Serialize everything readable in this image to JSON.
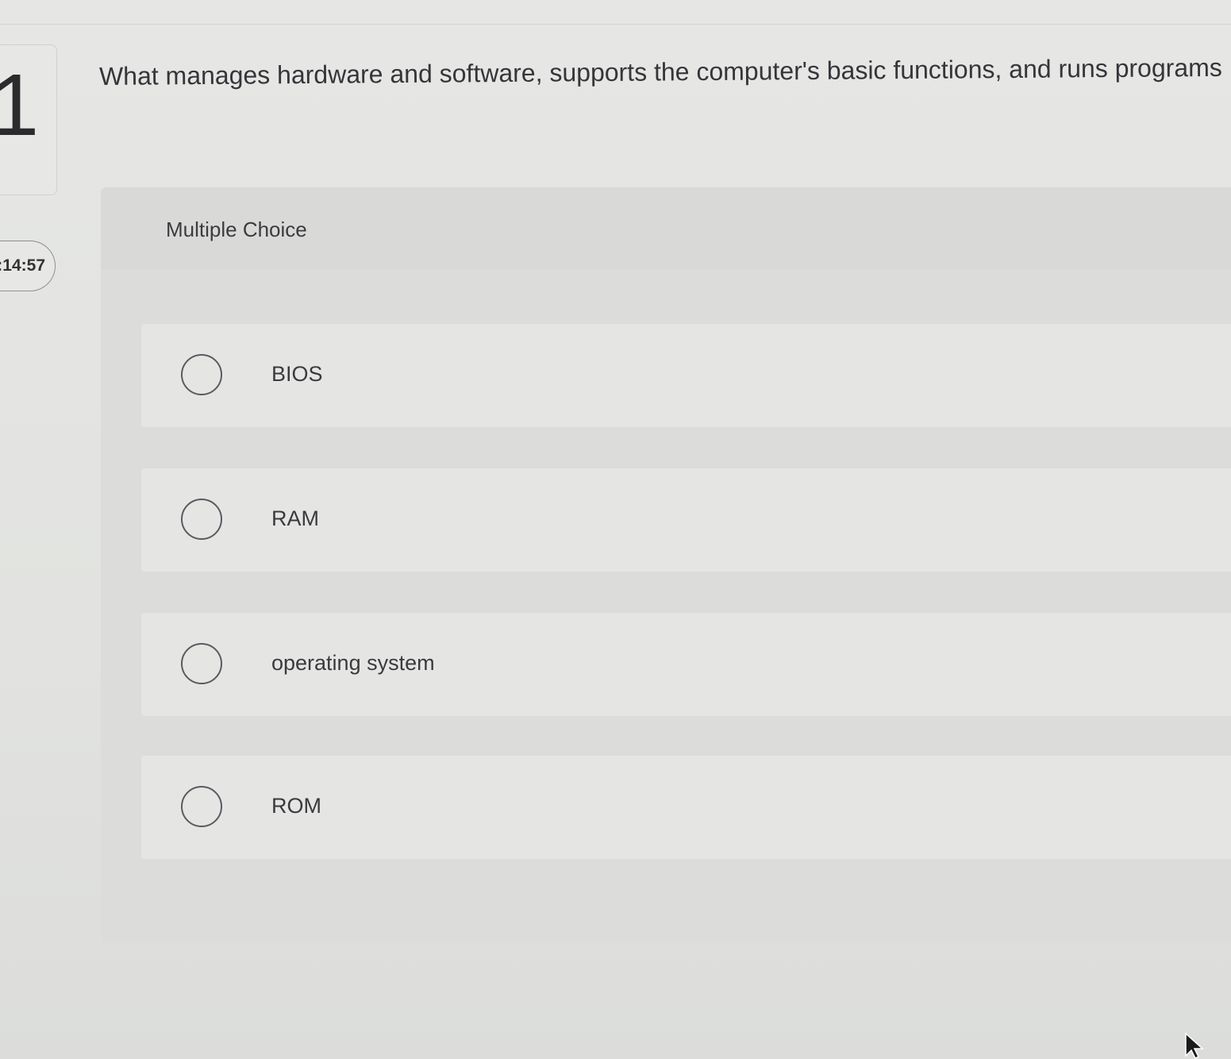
{
  "question": {
    "number": "1",
    "text": "What manages hardware and software, supports the computer's basic functions, and runs programs"
  },
  "timer": {
    "display": ":14:57"
  },
  "answer_area": {
    "type_label": "Multiple Choice",
    "options": [
      {
        "label": "BIOS",
        "selected": false
      },
      {
        "label": "RAM",
        "selected": false
      },
      {
        "label": "operating system",
        "selected": false
      },
      {
        "label": "ROM",
        "selected": false
      }
    ]
  },
  "colors": {
    "background": "#e3e4e2",
    "panel": "#dcdddb",
    "option_row": "#e5e6e4",
    "text": "#3a3a3c",
    "radio_border": "#5a5a62"
  },
  "icons": {
    "radio": "radio-button-empty-icon",
    "cursor": "mouse-pointer-icon"
  }
}
